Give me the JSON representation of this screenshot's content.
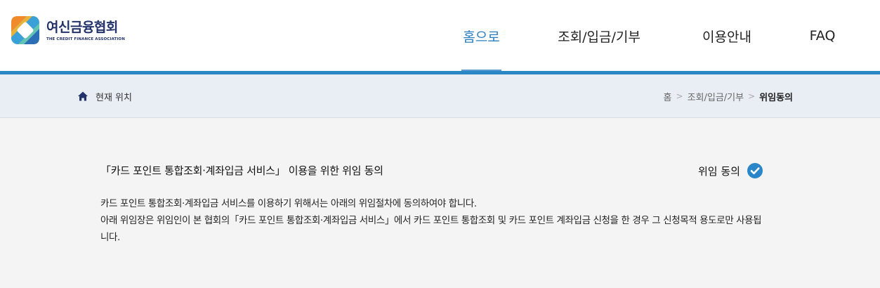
{
  "brand": {
    "name": "여신금융협회",
    "subtitle": "THE CREDIT FINANCE ASSOCIATION"
  },
  "nav": {
    "items": [
      {
        "label": "홈으로"
      },
      {
        "label": "조회/입금/기부"
      },
      {
        "label": "이용안내"
      },
      {
        "label": "FAQ"
      }
    ],
    "active_color": "#2a7fc0"
  },
  "location": {
    "label": "현재 위치",
    "breadcrumb": [
      "홈",
      "조회/입금/기부",
      "위임동의"
    ],
    "separator": ">"
  },
  "consent": {
    "title": "「카드 포인트 통합조회·계좌입금 서비스」 이용을 위한 위임 동의",
    "status_label": "위임 동의",
    "description_1": "카드 포인트 통합조회·계좌입금 서비스를 이용하기 위해서는 아래의 위임절차에 동의하여야 합니다.",
    "description_2": "아래 위임장은 위임인이 본 협회의「카드 포인트 통합조회·계좌입금 서비스」에서 카드 포인트 통합조회 및 카드 포인트 계좌입금 신청을 한 경우 그 신청목적 용도로만 사용됩니다."
  },
  "colors": {
    "accent": "#2b86c5",
    "brand_navy": "#23336a",
    "check": "#2a86c8"
  }
}
